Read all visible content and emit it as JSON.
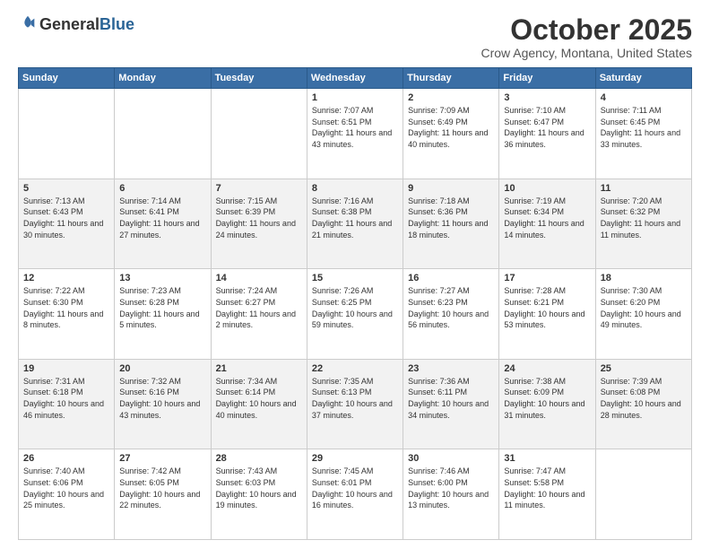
{
  "header": {
    "logo_general": "General",
    "logo_blue": "Blue",
    "month_title": "October 2025",
    "location": "Crow Agency, Montana, United States"
  },
  "calendar": {
    "days_of_week": [
      "Sunday",
      "Monday",
      "Tuesday",
      "Wednesday",
      "Thursday",
      "Friday",
      "Saturday"
    ],
    "weeks": [
      [
        {
          "day": "",
          "info": ""
        },
        {
          "day": "",
          "info": ""
        },
        {
          "day": "",
          "info": ""
        },
        {
          "day": "1",
          "info": "Sunrise: 7:07 AM\nSunset: 6:51 PM\nDaylight: 11 hours\nand 43 minutes."
        },
        {
          "day": "2",
          "info": "Sunrise: 7:09 AM\nSunset: 6:49 PM\nDaylight: 11 hours\nand 40 minutes."
        },
        {
          "day": "3",
          "info": "Sunrise: 7:10 AM\nSunset: 6:47 PM\nDaylight: 11 hours\nand 36 minutes."
        },
        {
          "day": "4",
          "info": "Sunrise: 7:11 AM\nSunset: 6:45 PM\nDaylight: 11 hours\nand 33 minutes."
        }
      ],
      [
        {
          "day": "5",
          "info": "Sunrise: 7:13 AM\nSunset: 6:43 PM\nDaylight: 11 hours\nand 30 minutes."
        },
        {
          "day": "6",
          "info": "Sunrise: 7:14 AM\nSunset: 6:41 PM\nDaylight: 11 hours\nand 27 minutes."
        },
        {
          "day": "7",
          "info": "Sunrise: 7:15 AM\nSunset: 6:39 PM\nDaylight: 11 hours\nand 24 minutes."
        },
        {
          "day": "8",
          "info": "Sunrise: 7:16 AM\nSunset: 6:38 PM\nDaylight: 11 hours\nand 21 minutes."
        },
        {
          "day": "9",
          "info": "Sunrise: 7:18 AM\nSunset: 6:36 PM\nDaylight: 11 hours\nand 18 minutes."
        },
        {
          "day": "10",
          "info": "Sunrise: 7:19 AM\nSunset: 6:34 PM\nDaylight: 11 hours\nand 14 minutes."
        },
        {
          "day": "11",
          "info": "Sunrise: 7:20 AM\nSunset: 6:32 PM\nDaylight: 11 hours\nand 11 minutes."
        }
      ],
      [
        {
          "day": "12",
          "info": "Sunrise: 7:22 AM\nSunset: 6:30 PM\nDaylight: 11 hours\nand 8 minutes."
        },
        {
          "day": "13",
          "info": "Sunrise: 7:23 AM\nSunset: 6:28 PM\nDaylight: 11 hours\nand 5 minutes."
        },
        {
          "day": "14",
          "info": "Sunrise: 7:24 AM\nSunset: 6:27 PM\nDaylight: 11 hours\nand 2 minutes."
        },
        {
          "day": "15",
          "info": "Sunrise: 7:26 AM\nSunset: 6:25 PM\nDaylight: 10 hours\nand 59 minutes."
        },
        {
          "day": "16",
          "info": "Sunrise: 7:27 AM\nSunset: 6:23 PM\nDaylight: 10 hours\nand 56 minutes."
        },
        {
          "day": "17",
          "info": "Sunrise: 7:28 AM\nSunset: 6:21 PM\nDaylight: 10 hours\nand 53 minutes."
        },
        {
          "day": "18",
          "info": "Sunrise: 7:30 AM\nSunset: 6:20 PM\nDaylight: 10 hours\nand 49 minutes."
        }
      ],
      [
        {
          "day": "19",
          "info": "Sunrise: 7:31 AM\nSunset: 6:18 PM\nDaylight: 10 hours\nand 46 minutes."
        },
        {
          "day": "20",
          "info": "Sunrise: 7:32 AM\nSunset: 6:16 PM\nDaylight: 10 hours\nand 43 minutes."
        },
        {
          "day": "21",
          "info": "Sunrise: 7:34 AM\nSunset: 6:14 PM\nDaylight: 10 hours\nand 40 minutes."
        },
        {
          "day": "22",
          "info": "Sunrise: 7:35 AM\nSunset: 6:13 PM\nDaylight: 10 hours\nand 37 minutes."
        },
        {
          "day": "23",
          "info": "Sunrise: 7:36 AM\nSunset: 6:11 PM\nDaylight: 10 hours\nand 34 minutes."
        },
        {
          "day": "24",
          "info": "Sunrise: 7:38 AM\nSunset: 6:09 PM\nDaylight: 10 hours\nand 31 minutes."
        },
        {
          "day": "25",
          "info": "Sunrise: 7:39 AM\nSunset: 6:08 PM\nDaylight: 10 hours\nand 28 minutes."
        }
      ],
      [
        {
          "day": "26",
          "info": "Sunrise: 7:40 AM\nSunset: 6:06 PM\nDaylight: 10 hours\nand 25 minutes."
        },
        {
          "day": "27",
          "info": "Sunrise: 7:42 AM\nSunset: 6:05 PM\nDaylight: 10 hours\nand 22 minutes."
        },
        {
          "day": "28",
          "info": "Sunrise: 7:43 AM\nSunset: 6:03 PM\nDaylight: 10 hours\nand 19 minutes."
        },
        {
          "day": "29",
          "info": "Sunrise: 7:45 AM\nSunset: 6:01 PM\nDaylight: 10 hours\nand 16 minutes."
        },
        {
          "day": "30",
          "info": "Sunrise: 7:46 AM\nSunset: 6:00 PM\nDaylight: 10 hours\nand 13 minutes."
        },
        {
          "day": "31",
          "info": "Sunrise: 7:47 AM\nSunset: 5:58 PM\nDaylight: 10 hours\nand 11 minutes."
        },
        {
          "day": "",
          "info": ""
        }
      ]
    ]
  }
}
